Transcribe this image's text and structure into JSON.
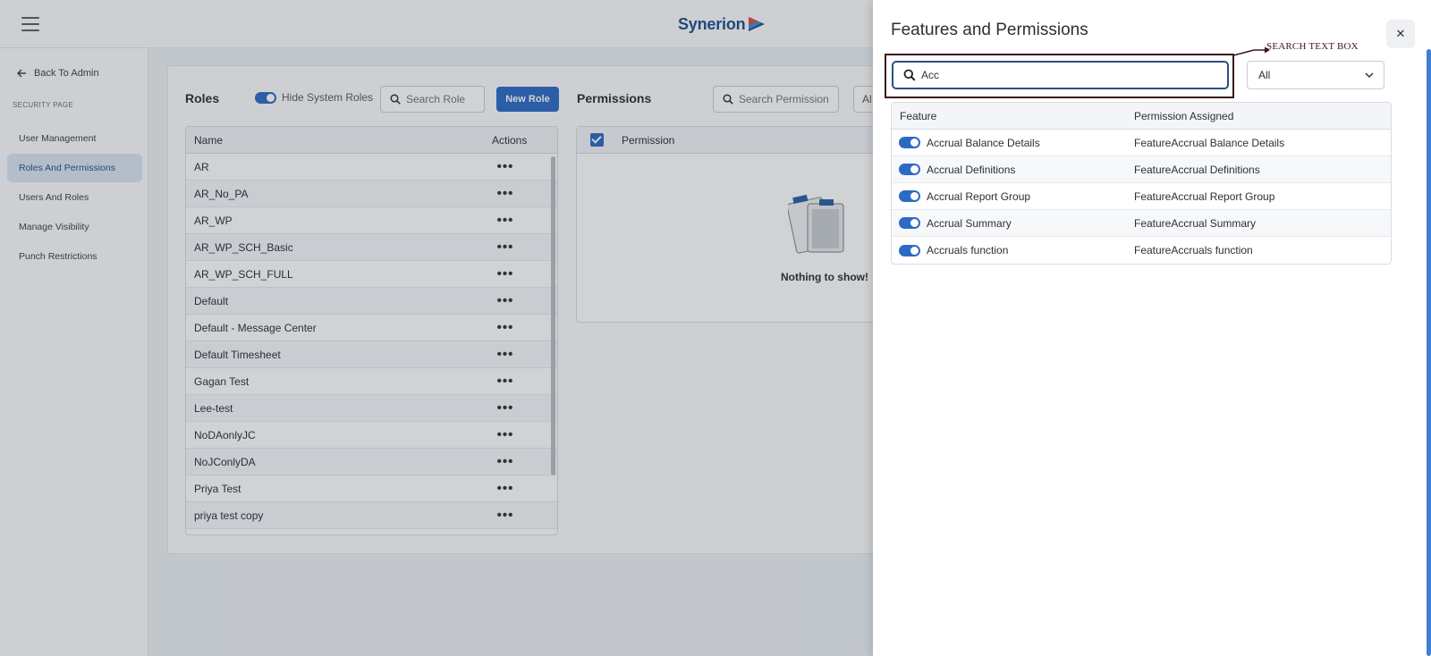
{
  "header": {
    "logo_text": "Synerion"
  },
  "sidebar": {
    "back_label": "Back To Admin",
    "section_label": "SECURITY PAGE",
    "items": [
      {
        "label": "User Management"
      },
      {
        "label": "Roles And Permissions",
        "active": true
      },
      {
        "label": "Users And Roles"
      },
      {
        "label": "Manage Visibility"
      },
      {
        "label": "Punch Restrictions"
      }
    ]
  },
  "roles": {
    "title": "Roles",
    "hide_system_label": "Hide System Roles",
    "search_placeholder": "Search Role",
    "new_button": "New Role",
    "columns": {
      "name": "Name",
      "actions": "Actions"
    },
    "rows": [
      "AR",
      "AR_No_PA",
      "AR_WP",
      "AR_WP_SCH_Basic",
      "AR_WP_SCH_FULL",
      "Default",
      "Default - Message Center",
      "Default Timesheet",
      "Gagan Test",
      "Lee-test",
      "NoDAonlyJC",
      "NoJConlyDA",
      "Priya Test",
      "priya test copy"
    ],
    "actions_glyph": "•••"
  },
  "permissions": {
    "title": "Permissions",
    "search_placeholder": "Search Permission",
    "filter_partial": "Al",
    "column": "Permission",
    "empty_text": "Nothing to show!"
  },
  "drawer": {
    "title": "Features and Permissions",
    "close_glyph": "✕",
    "search_value": "Acc",
    "annotation": "SEARCH TEXT BOX",
    "select_value": "All",
    "columns": {
      "feature": "Feature",
      "permission": "Permission Assigned"
    },
    "rows": [
      {
        "feature": "Accrual Balance Details",
        "permission": "FeatureAccrual Balance Details"
      },
      {
        "feature": "Accrual Definitions",
        "permission": "FeatureAccrual Definitions"
      },
      {
        "feature": "Accrual Report Group",
        "permission": "FeatureAccrual Report Group"
      },
      {
        "feature": "Accrual Summary",
        "permission": "FeatureAccrual Summary"
      },
      {
        "feature": "Accruals function",
        "permission": "FeatureAccruals function"
      }
    ]
  },
  "colors": {
    "accent": "#2d6ac6",
    "brand": "#1d4f91",
    "annotation": "#3a1a1a"
  }
}
